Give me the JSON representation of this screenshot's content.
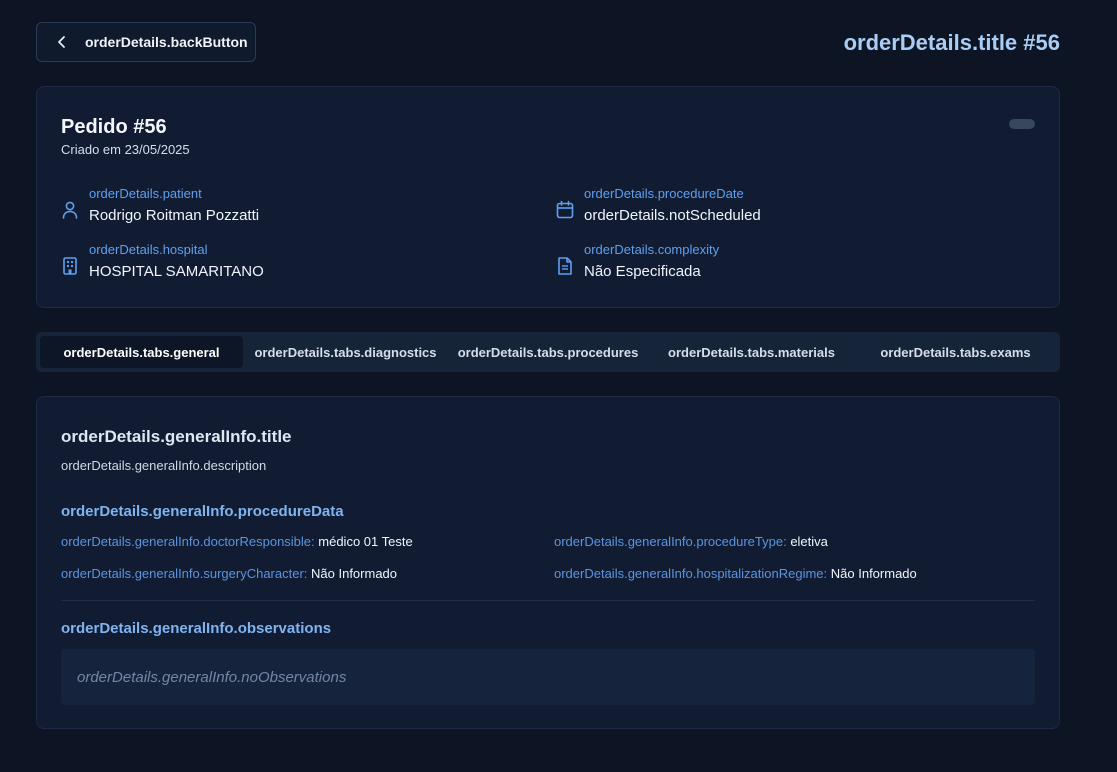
{
  "header": {
    "back_label": "orderDetails.backButton",
    "title": "orderDetails.title #56"
  },
  "order": {
    "title": "Pedido #56",
    "created": "Criado em 23/05/2025",
    "fields": {
      "patient": {
        "label": "orderDetails.patient",
        "value": "Rodrigo Roitman Pozzatti"
      },
      "procedure_date": {
        "label": "orderDetails.procedureDate",
        "value": "orderDetails.notScheduled"
      },
      "hospital": {
        "label": "orderDetails.hospital",
        "value": "HOSPITAL SAMARITANO"
      },
      "complexity": {
        "label": "orderDetails.complexity",
        "value": "Não Especificada"
      }
    }
  },
  "tabs": [
    {
      "label": "orderDetails.tabs.general",
      "active": true
    },
    {
      "label": "orderDetails.tabs.diagnostics",
      "active": false
    },
    {
      "label": "orderDetails.tabs.procedures",
      "active": false
    },
    {
      "label": "orderDetails.tabs.materials",
      "active": false
    },
    {
      "label": "orderDetails.tabs.exams",
      "active": false
    }
  ],
  "general": {
    "title": "orderDetails.generalInfo.title",
    "description": "orderDetails.generalInfo.description",
    "procedure_section": "orderDetails.generalInfo.procedureData",
    "doctor": {
      "label": "orderDetails.generalInfo.doctorResponsible:",
      "value": "médico 01 Teste"
    },
    "procedure_type": {
      "label": "orderDetails.generalInfo.procedureType:",
      "value": "eletiva"
    },
    "surgery_character": {
      "label": "orderDetails.generalInfo.surgeryCharacter:",
      "value": "Não Informado"
    },
    "hospitalization_regime": {
      "label": "orderDetails.generalInfo.hospitalizationRegime:",
      "value": "Não Informado"
    },
    "observations_section": "orderDetails.generalInfo.observations",
    "no_observations": "orderDetails.generalInfo.noObservations"
  },
  "icons": {
    "back": "chevron-left-icon",
    "patient": "user-icon",
    "procedure_date": "calendar-icon",
    "hospital": "building-icon",
    "complexity": "document-icon"
  },
  "colors": {
    "background": "#0d1524",
    "card": "#111c33",
    "accent": "#5ea0ee",
    "title_accent": "#a9cdf5"
  }
}
